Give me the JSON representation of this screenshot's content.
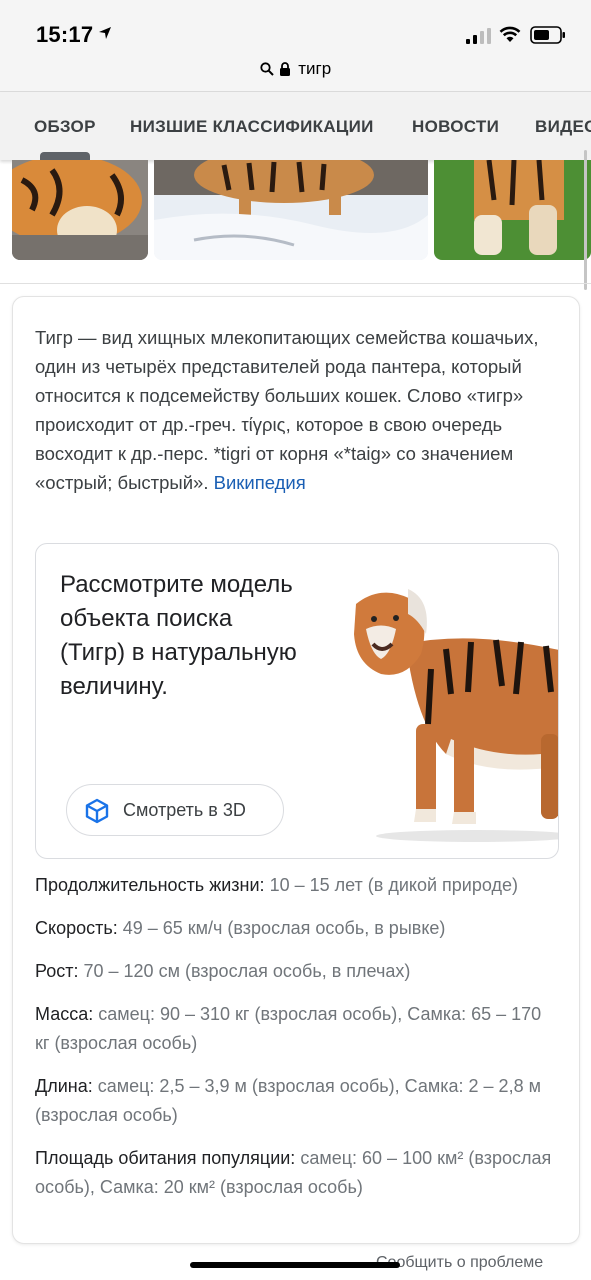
{
  "status": {
    "time": "15:17"
  },
  "urlbar": {
    "text": "тигр"
  },
  "tabs": [
    {
      "label": "ОБЗОР",
      "active": true
    },
    {
      "label": "НИЗШИЕ КЛАССИФИКАЦИИ"
    },
    {
      "label": "НОВОСТИ"
    },
    {
      "label": "ВИДЕО"
    }
  ],
  "card": {
    "description": "Тигр — вид хищных млекопитающих семейства кошачьих, один из четырёх представителей рода пантера, который относится к подсемейству больших кошек. Слово «тигр» происходит от др.-греч. τίγρις, которое в свою очередь восходит к др.-перс. *tigri от корня «*taig» со значением «острый; быстрый».",
    "source": "Википедия",
    "ar": {
      "text": "Рассмотрите модель объекта поиска (Тигр) в натуральную величину.",
      "button": "Смотреть в 3D"
    },
    "facts": [
      {
        "label": "Продолжительность жизни:",
        "value": "10 – 15 лет (в дикой природе)"
      },
      {
        "label": "Скорость:",
        "value": "49 – 65 км/ч (взрослая особь, в рывке)"
      },
      {
        "label": "Рост:",
        "value": "70 – 120 см (взрослая особь, в плечах)"
      },
      {
        "label": "Масса:",
        "value": "самец: 90 – 310 кг (взрослая особь), Самка: 65 – 170 кг (взрослая особь)"
      },
      {
        "label": "Длина:",
        "value": "самец: 2,5 – 3,9 м (взрослая особь), Самка: 2 – 2,8 м (взрослая особь)"
      },
      {
        "label": "Площадь обитания популяции:",
        "value": "самец: 60 – 100 км² (взрослая особь), Самка: 20 км² (взрослая особь)"
      }
    ]
  },
  "footer": {
    "report": "Сообщить о проблеме"
  },
  "colors": {
    "link": "#1a5fb4",
    "tab_bg": "#f2f2f2",
    "text": "#202124",
    "muted": "#70757a"
  }
}
